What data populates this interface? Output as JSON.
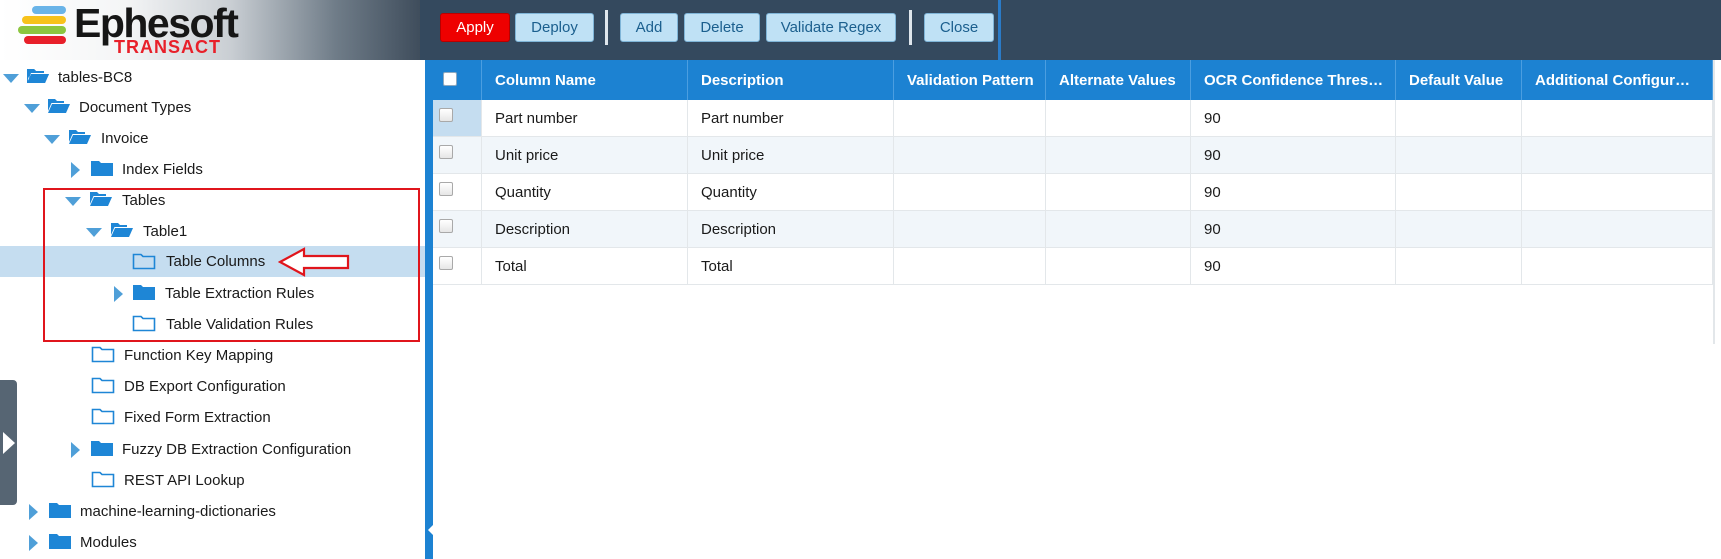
{
  "app": {
    "logo_text": "Ephesoft",
    "logo_subtext": "TRANSACT"
  },
  "toolbar": {
    "apply_label": "Apply",
    "deploy_label": "Deploy",
    "add_label": "Add",
    "delete_label": "Delete",
    "validate_regex_label": "Validate Regex",
    "close_label": "Close"
  },
  "tree": {
    "root": "tables-BC8",
    "document_types": "Document Types",
    "invoice": "Invoice",
    "index_fields": "Index Fields",
    "tables": "Tables",
    "table1": "Table1",
    "table_columns": "Table Columns",
    "table_extraction_rules": "Table Extraction Rules",
    "table_validation_rules": "Table Validation Rules",
    "function_key_mapping": "Function Key Mapping",
    "db_export_configuration": "DB Export Configuration",
    "fixed_form_extraction": "Fixed Form Extraction",
    "fuzzy_db_extraction_configuration": "Fuzzy DB Extraction Configuration",
    "rest_api_lookup": "REST API Lookup",
    "machine_learning_dictionaries": "machine-learning-dictionaries",
    "modules": "Modules"
  },
  "grid": {
    "headers": [
      "Column Name",
      "Description",
      "Validation Pattern",
      "Alternate Values",
      "OCR Confidence Thres…",
      "Default Value",
      "Additional Configur…"
    ],
    "rows": [
      [
        "Part number",
        "Part number",
        "",
        "",
        "90",
        "",
        ""
      ],
      [
        "Unit price",
        "Unit price",
        "",
        "",
        "90",
        "",
        ""
      ],
      [
        "Quantity",
        "Quantity",
        "",
        "",
        "90",
        "",
        ""
      ],
      [
        "Description",
        "Description",
        "",
        "",
        "90",
        "",
        ""
      ],
      [
        "Total",
        "Total",
        "",
        "",
        "90",
        "",
        ""
      ]
    ]
  },
  "colors": {
    "header_bg": "#34495e",
    "accent_blue": "#1c82d2",
    "apply_red": "#ee0000",
    "annotation_red": "#e0151c",
    "selection_blue": "#c5ddf0",
    "folder_blue": "#1e86d6"
  },
  "icons": {
    "folder_open": "folder-open-icon",
    "folder_closed": "folder-icon",
    "folder_outline": "folder-outline-icon",
    "expand": "chevron-right-icon",
    "collapse": "chevron-down-icon",
    "annotation_arrow": "arrow-left-icon"
  }
}
